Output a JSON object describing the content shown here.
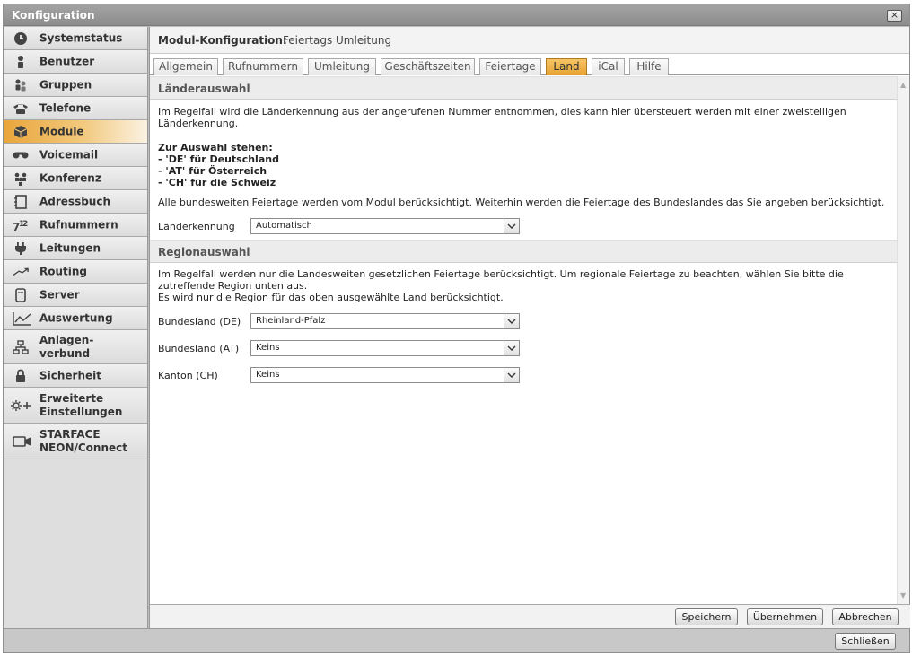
{
  "window": {
    "title": "Konfiguration",
    "close_glyph": "×"
  },
  "sidebar": {
    "items": [
      {
        "label": "Systemstatus",
        "icon": "clock-icon",
        "active": false
      },
      {
        "label": "Benutzer",
        "icon": "user-icon",
        "active": false
      },
      {
        "label": "Gruppen",
        "icon": "group-icon",
        "active": false
      },
      {
        "label": "Telefone",
        "icon": "phone-icon",
        "active": false
      },
      {
        "label": "Module",
        "icon": "cube-icon",
        "active": true
      },
      {
        "label": "Voicemail",
        "icon": "voicemail-icon",
        "active": false
      },
      {
        "label": "Konferenz",
        "icon": "conference-icon",
        "active": false
      },
      {
        "label": "Adressbuch",
        "icon": "addressbook-icon",
        "active": false
      },
      {
        "label": "Rufnummern",
        "icon": "numbers-icon",
        "active": false
      },
      {
        "label": "Leitungen",
        "icon": "plug-icon",
        "active": false
      },
      {
        "label": "Routing",
        "icon": "routing-icon",
        "active": false
      },
      {
        "label": "Server",
        "icon": "server-icon",
        "active": false
      },
      {
        "label": "Auswertung",
        "icon": "chart-icon",
        "active": false
      },
      {
        "label": "Anlagen-\nverbund",
        "icon": "network-icon",
        "active": false
      },
      {
        "label": "Sicherheit",
        "icon": "lock-icon",
        "active": false
      },
      {
        "label": "Erweiterte\nEinstellungen",
        "icon": "settings-plus-icon",
        "active": false
      },
      {
        "label": "STARFACE\nNEON/Connect",
        "icon": "camera-icon",
        "active": false
      }
    ]
  },
  "module": {
    "label": "Modul-Konfiguration:",
    "name": "Feiertags Umleitung"
  },
  "tabs": [
    {
      "label": "Allgemein",
      "active": false
    },
    {
      "label": "Rufnummern",
      "active": false
    },
    {
      "label": "Umleitung",
      "active": false
    },
    {
      "label": "Geschäftszeiten",
      "active": false
    },
    {
      "label": "Feiertage",
      "active": false
    },
    {
      "label": "Land",
      "active": true
    },
    {
      "label": "iCal",
      "active": false
    },
    {
      "label": "Hilfe",
      "active": false
    }
  ],
  "laenderauswahl": {
    "title": "Länderauswahl",
    "intro": "Im Regelfall wird die Länderkennung aus der angerufenen Nummer entnommen, dies kann hier übersteuert werden mit einer zweistelligen Länderkennung.",
    "options_title": "Zur Auswahl stehen:",
    "options": [
      "- 'DE' für Deutschland",
      "- 'AT' für Österreich",
      "- 'CH' für die Schweiz"
    ],
    "note": "Alle bundesweiten Feiertage werden vom Modul berücksichtigt. Weiterhin werden die Feiertage des Bundeslandes das Sie angeben berücksichtigt.",
    "field_label": "Länderkennung",
    "field_value": "Automatisch"
  },
  "regionauswahl": {
    "title": "Regionauswahl",
    "intro": "Im Regelfall werden nur die Landesweiten gesetzlichen Feiertage berücksichtigt. Um regionale Feiertage zu beachten, wählen Sie bitte die zutreffende Region unten aus.",
    "note": "Es wird nur die Region für das oben ausgewählte Land berücksichtigt.",
    "fields": [
      {
        "label": "Bundesland (DE)",
        "value": "Rheinland-Pfalz"
      },
      {
        "label": "Bundesland (AT)",
        "value": "Keins"
      },
      {
        "label": "Kanton (CH)",
        "value": "Keins"
      }
    ]
  },
  "footer": {
    "save": "Speichern",
    "apply": "Übernehmen",
    "cancel": "Abbrechen"
  },
  "bottom": {
    "close": "Schließen"
  },
  "colors": {
    "accent": "#e6a231",
    "titlebar": "#9a9a9a"
  }
}
